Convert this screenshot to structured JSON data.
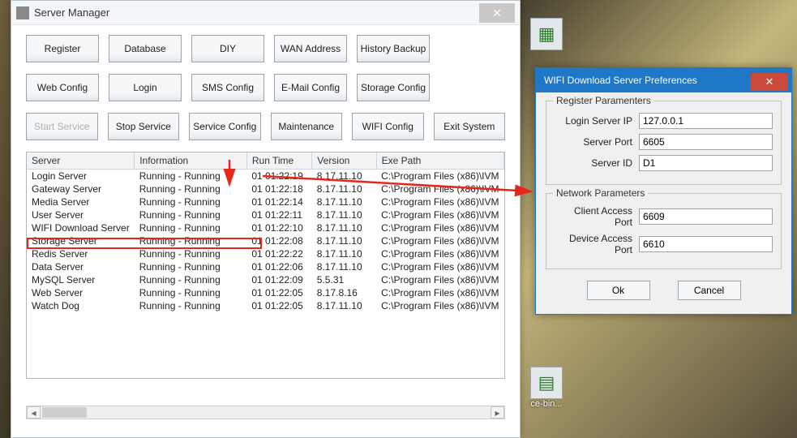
{
  "desktop": {
    "icon1_label": "",
    "icon2_label": "ce-bin..."
  },
  "serverManager": {
    "title": "Server Manager",
    "buttons": {
      "register": "Register",
      "database": "Database",
      "diy": "DIY",
      "wan": "WAN Address",
      "history": "History Backup",
      "webconfig": "Web Config",
      "login": "Login",
      "smsconfig": "SMS Config",
      "emailconfig": "E-Mail Config",
      "storageconfig": "Storage Config",
      "startservice": "Start Service",
      "stopservice": "Stop Service",
      "serviceconfig": "Service Config",
      "maintenance": "Maintenance",
      "wificonfig": "WIFI Config",
      "exitsystem": "Exit System"
    },
    "columns": {
      "server": "Server",
      "info": "Information",
      "runtime": "Run Time",
      "version": "Version",
      "exepath": "Exe Path"
    },
    "rows": [
      {
        "server": "Login Server",
        "info": "Running - Running",
        "runtime": "01 01:22:19",
        "version": "8.17.11.10",
        "exe": "C:\\Program Files (x86)\\IVM"
      },
      {
        "server": "Gateway Server",
        "info": "Running - Running",
        "runtime": "01 01:22:18",
        "version": "8.17.11.10",
        "exe": "C:\\Program Files (x86)\\IVM"
      },
      {
        "server": "Media Server",
        "info": "Running - Running",
        "runtime": "01 01:22:14",
        "version": "8.17.11.10",
        "exe": "C:\\Program Files (x86)\\IVM"
      },
      {
        "server": "User Server",
        "info": "Running - Running",
        "runtime": "01 01:22:11",
        "version": "8.17.11.10",
        "exe": "C:\\Program Files (x86)\\IVM"
      },
      {
        "server": "WIFI Download Server",
        "info": "Running - Running",
        "runtime": "01 01:22:10",
        "version": "8.17.11.10",
        "exe": "C:\\Program Files (x86)\\IVM"
      },
      {
        "server": "Storage Server",
        "info": "Running - Running",
        "runtime": "01 01:22:08",
        "version": "8.17.11.10",
        "exe": "C:\\Program Files (x86)\\IVM"
      },
      {
        "server": "Redis Server",
        "info": "Running - Running",
        "runtime": "01 01:22:22",
        "version": "8.17.11.10",
        "exe": "C:\\Program Files (x86)\\IVM"
      },
      {
        "server": "Data Server",
        "info": "Running - Running",
        "runtime": "01 01:22:06",
        "version": "8.17.11.10",
        "exe": "C:\\Program Files (x86)\\IVM"
      },
      {
        "server": "MySQL Server",
        "info": "Running - Running",
        "runtime": "01 01:22:09",
        "version": "5.5.31",
        "exe": "C:\\Program Files (x86)\\IVM"
      },
      {
        "server": "Web Server",
        "info": "Running - Running",
        "runtime": "01 01:22:05",
        "version": "8.17.8.16",
        "exe": "C:\\Program Files (x86)\\IVM"
      },
      {
        "server": "Watch Dog",
        "info": "Running - Running",
        "runtime": "01 01:22:05",
        "version": "8.17.11.10",
        "exe": "C:\\Program Files (x86)\\IVM"
      }
    ]
  },
  "prefs": {
    "title": "WIFI Download Server Preferences",
    "group1": "Register Paramenters",
    "group2": "Network Parameters",
    "labels": {
      "loginip": "Login Server IP",
      "serverport": "Server Port",
      "serverid": "Server ID",
      "clientport": "Client Access Port",
      "deviceport": "Device Access Port"
    },
    "values": {
      "loginip": "127.0.0.1",
      "serverport": "6605",
      "serverid": "D1",
      "clientport": "6609",
      "deviceport": "6610"
    },
    "ok": "Ok",
    "cancel": "Cancel"
  }
}
